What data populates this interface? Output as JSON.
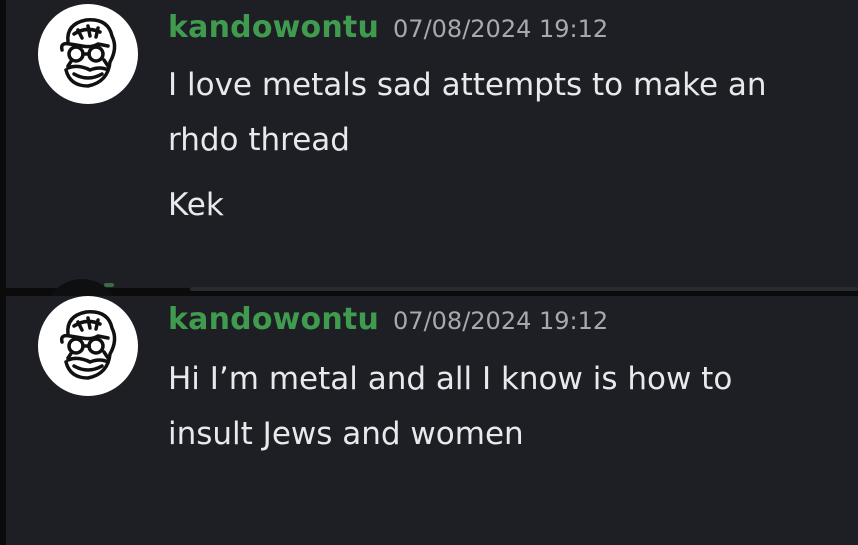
{
  "messages": [
    {
      "avatar_icon": "cartoon-face-avatar-icon",
      "username": "kandowontu",
      "timestamp": "07/08/2024 19:12",
      "lines": [
        "I love metals sad attempts to make an",
        "rhdo thread",
        "Kek"
      ]
    },
    {
      "avatar_icon": "cartoon-face-avatar-icon",
      "username": "kandowontu",
      "timestamp": "07/08/2024 19:12",
      "lines": [
        "Hi I’m metal and all I know is how to",
        "insult Jews and women"
      ]
    }
  ],
  "colors": {
    "background": "#1e1f24",
    "username": "#3f9c4e",
    "timestamp": "#a7a9b0",
    "text": "#e8e9ec"
  }
}
